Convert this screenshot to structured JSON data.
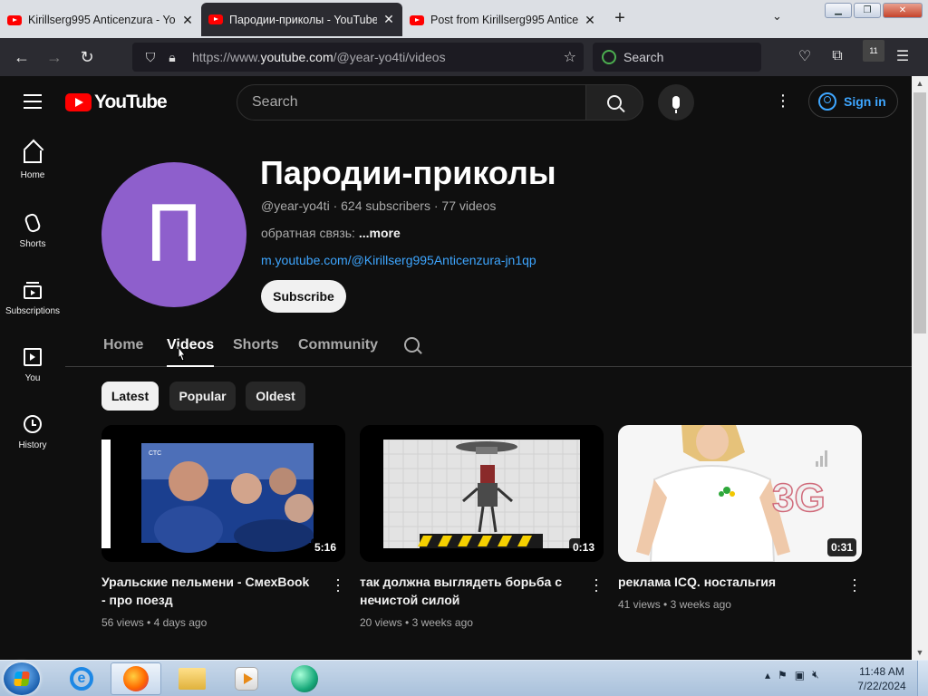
{
  "browser": {
    "tabs": [
      {
        "label": "Kirillserg995 Anticenzura - YouTube",
        "active": false
      },
      {
        "label": "Пародии-приколы - YouTube",
        "active": true
      },
      {
        "label": "Post from Kirillserg995 Anticenzura",
        "active": false
      }
    ],
    "close_glyph": "✕",
    "new_tab_glyph": "+",
    "tab_list_glyph": "⌄",
    "window": {
      "minimize": "▁",
      "restore": "❐",
      "close": "✕"
    },
    "url_prefix": "https://www.",
    "url_host": "youtube.com",
    "url_path": "/@year-yo4ti/videos",
    "search_placeholder": "Search",
    "ublock_count": "11"
  },
  "youtube": {
    "logo_text": "YouTube",
    "search_placeholder": "Search",
    "sign_in": "Sign in",
    "sidebar": [
      {
        "label": "Home",
        "icon": "home-icon"
      },
      {
        "label": "Shorts",
        "icon": "shorts-icon"
      },
      {
        "label": "Subscriptions",
        "icon": "subscriptions-icon"
      },
      {
        "label": "You",
        "icon": "you-icon"
      },
      {
        "label": "History",
        "icon": "history-icon"
      }
    ],
    "channel": {
      "avatar_letter": "П",
      "avatar_color": "#8e5fcc",
      "name": "Пародии-приколы",
      "handle": "@year-yo4ti",
      "subscribers": "624 subscribers",
      "videos_count": "77 videos",
      "separator": " · ",
      "description": "обратная связь: ",
      "more": "...more",
      "link": "m.youtube.com/@Kirillserg995Anticenzura-jn1qp",
      "subscribe": "Subscribe"
    },
    "tabs": [
      "Home",
      "Videos",
      "Shorts",
      "Community"
    ],
    "selected_tab": "Videos",
    "chips": [
      "Latest",
      "Popular",
      "Oldest"
    ],
    "selected_chip": "Latest",
    "videos": [
      {
        "title": "Уральские пельмени - СмехBook - про поезд",
        "views": "56 views",
        "age": "4 days ago",
        "duration": "5:16"
      },
      {
        "title": "так должна выглядеть борьба с нечистой силой",
        "views": "20 views",
        "age": "3 weeks ago",
        "duration": "0:13"
      },
      {
        "title": "реклама ICQ. ностальгия",
        "views": "41 views",
        "age": "3 weeks ago",
        "duration": "0:31"
      }
    ],
    "thumb_text": {
      "ctc": "СТС",
      "net": "3G"
    }
  },
  "taskbar": {
    "clock_time": "11:48 AM",
    "clock_date": "7/22/2024"
  }
}
